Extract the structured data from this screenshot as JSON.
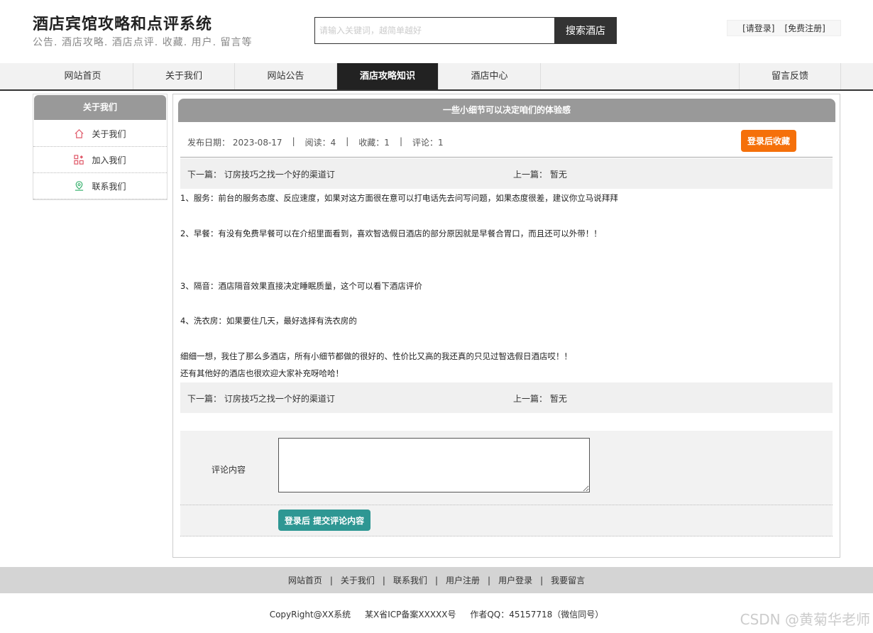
{
  "header": {
    "title": "酒店宾馆攻略和点评系统",
    "subtitle": "公告. 酒店攻略. 酒店点评. 收藏. 用户. 留言等",
    "search_placeholder": "请输入关键词，越简单越好",
    "search_button": "搜索酒店",
    "login_link": "[请登录]",
    "register_link": "[免费注册]"
  },
  "nav": {
    "items": [
      "网站首页",
      "关于我们",
      "网站公告",
      "酒店攻略知识",
      "酒店中心",
      "留言反馈"
    ],
    "active": "酒店攻略知识"
  },
  "sidebar": {
    "title": "关于我们",
    "items": [
      {
        "label": "关于我们",
        "icon": "home-icon"
      },
      {
        "label": "加入我们",
        "icon": "grid-icon"
      },
      {
        "label": "联系我们",
        "icon": "location-icon"
      }
    ]
  },
  "article": {
    "title": "一些小细节可以决定咱们的体验感",
    "publish_date": "发布日期：  2023-08-17",
    "reads": "阅读：4",
    "favorites": "收藏：1",
    "comments": "评论：1",
    "favorite_button": "登录后收藏",
    "next_label": "下一篇：  订房技巧之找一个好的渠道订",
    "prev_label": "上一篇：  暂无",
    "paragraphs": [
      "1、服务：前台的服务态度、反应速度，如果对这方面很在意可以打电话先去问写问题，如果态度很差，建议你立马说拜拜",
      "2、早餐：有没有免费早餐可以在介绍里面看到，喜欢智选假日酒店的部分原因就是早餐合胃口，而且还可以外带！！",
      "3、隔音：酒店隔音效果直接决定睡眠质量，这个可以看下酒店评价",
      "4、洗衣房：如果要住几天，最好选择有洗衣房的",
      "细细一想，我住了那么多酒店，所有小细节都做的很好的、性价比又高的我还真的只见过智选假日酒店哎！！",
      "还有其他好的酒店也很欢迎大家补充呀哈哈！"
    ]
  },
  "comment": {
    "label": "评论内容",
    "textarea_value": "",
    "submit_button": "登录后 提交评论内容"
  },
  "footer": {
    "links": [
      "网站首页",
      "关于我们",
      "联系我们",
      "用户注册",
      "用户登录",
      "我要留言"
    ],
    "copyright": "CopyRight@XX系统",
    "icp": "某X省ICP备案XXXXX号",
    "author": "作者QQ：45157718（微信同号）",
    "watermark": "CSDN @黄菊华老师"
  }
}
